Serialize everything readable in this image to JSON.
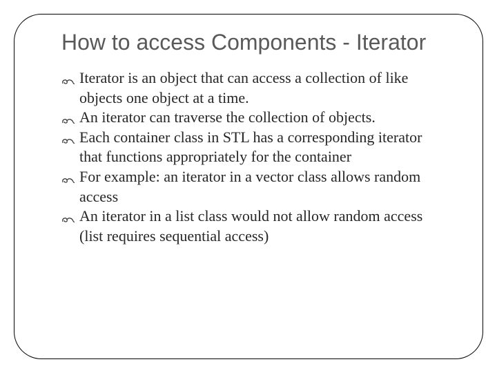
{
  "title": "How to access Components - Iterator",
  "bullets": [
    "Iterator is an object that can access a collection of like objects one object at a time.",
    "An iterator can traverse the collection of objects.",
    "Each container class in STL has a corresponding iterator that functions appropriately for the container",
    "For example:  an iterator in a vector class allows random access",
    "An iterator in a list class would not allow random access (list requires sequential access)"
  ]
}
